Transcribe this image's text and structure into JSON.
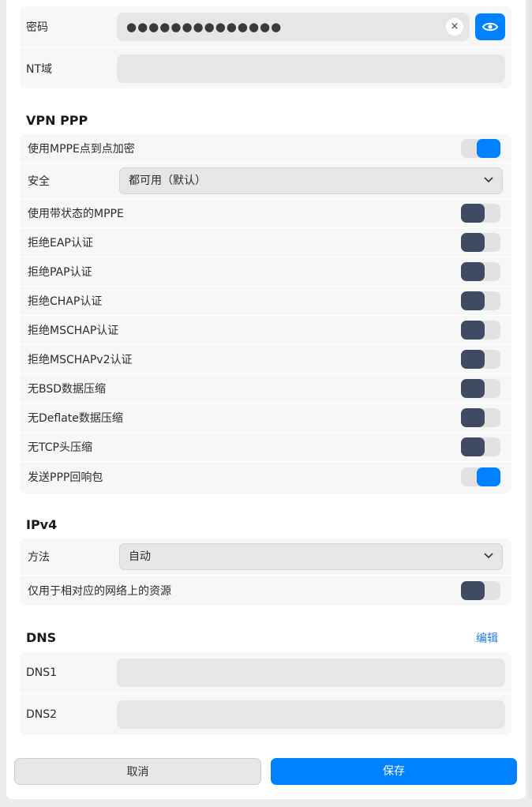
{
  "auth": {
    "password_label": "密码",
    "password_value": "●●●●●●●●●●●●●●",
    "clear_glyph": "×",
    "nt_domain_label": "NT域",
    "nt_domain_value": ""
  },
  "vpn_ppp": {
    "title": "VPN PPP",
    "mppe": {
      "label": "使用MPPE点到点加密",
      "on": true
    },
    "security": {
      "label": "安全",
      "value": "都可用（默认）"
    },
    "toggles": [
      {
        "label": "使用带状态的MPPE",
        "on": false
      },
      {
        "label": "拒绝EAP认证",
        "on": false
      },
      {
        "label": "拒绝PAP认证",
        "on": false
      },
      {
        "label": "拒绝CHAP认证",
        "on": false
      },
      {
        "label": "拒绝MSCHAP认证",
        "on": false
      },
      {
        "label": "拒绝MSCHAPv2认证",
        "on": false
      },
      {
        "label": "无BSD数据压缩",
        "on": false
      },
      {
        "label": "无Deflate数据压缩",
        "on": false
      },
      {
        "label": "无TCP头压缩",
        "on": false
      },
      {
        "label": "发送PPP回响包",
        "on": true
      }
    ]
  },
  "ipv4": {
    "title": "IPv4",
    "method": {
      "label": "方法",
      "value": "自动"
    },
    "only_local": {
      "label": "仅用于相对应的网络上的资源",
      "on": false
    }
  },
  "dns": {
    "title": "DNS",
    "edit_label": "编辑",
    "dns1_label": "DNS1",
    "dns1_value": "",
    "dns2_label": "DNS2",
    "dns2_value": ""
  },
  "footer": {
    "cancel_label": "取消",
    "save_label": "保存"
  },
  "colors": {
    "accent": "#0081ff",
    "toggle_off_knob": "#3f4a63"
  }
}
